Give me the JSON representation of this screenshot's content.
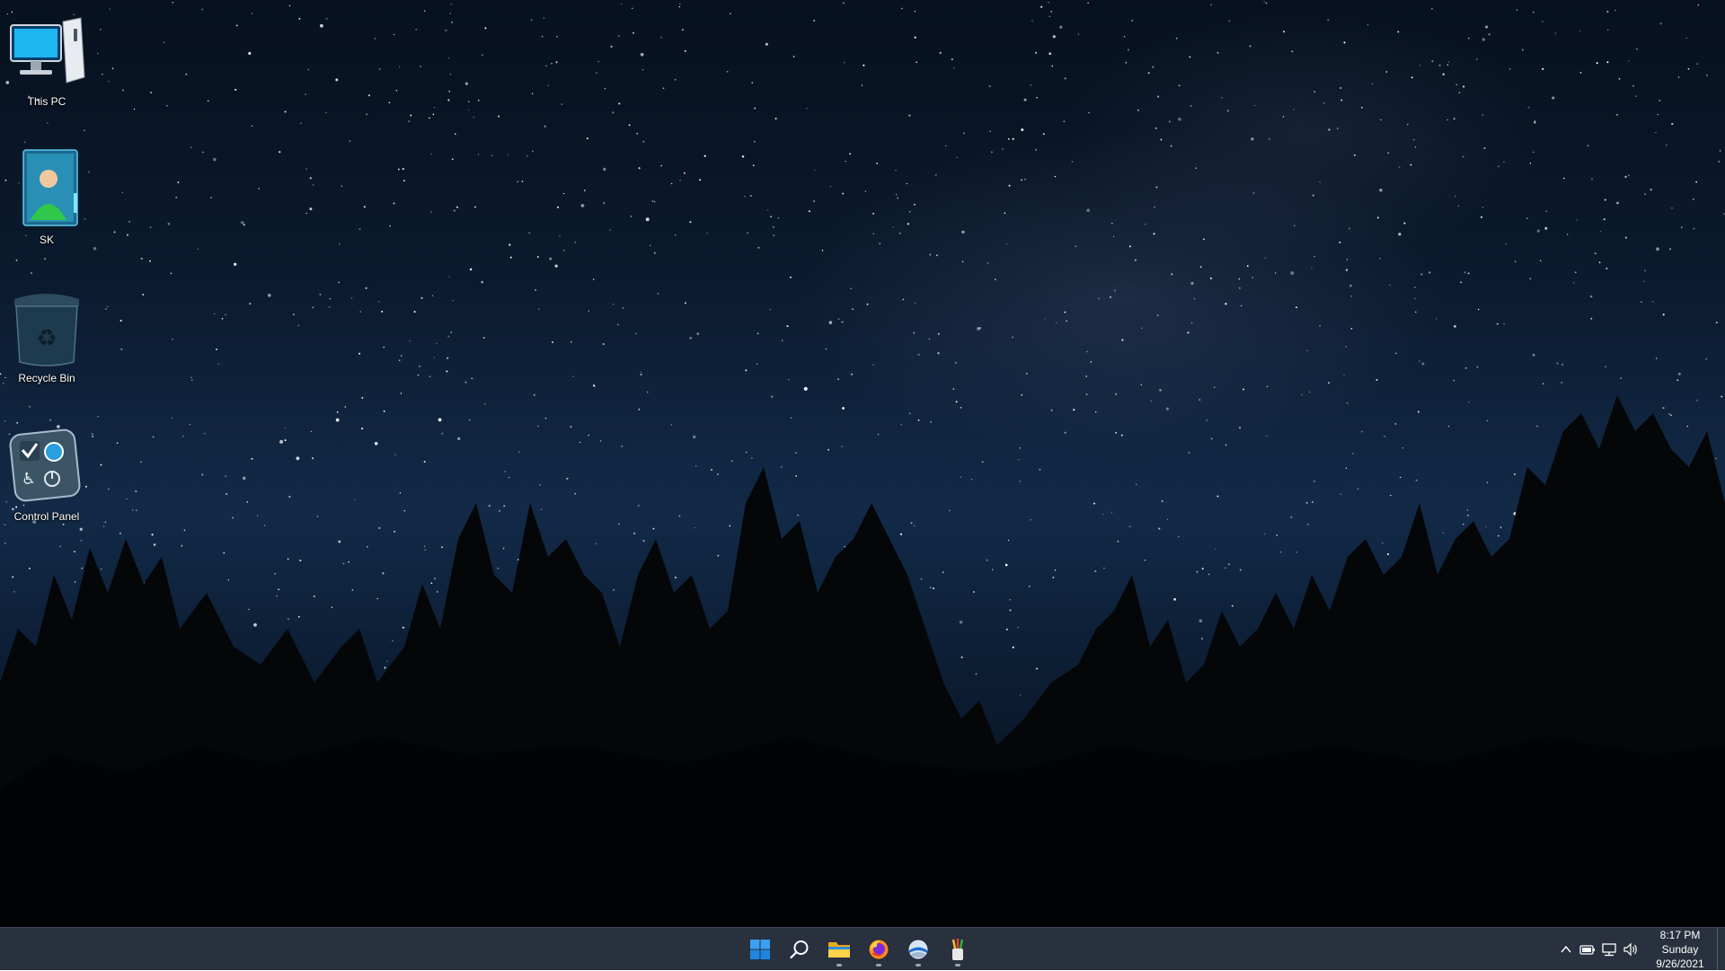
{
  "desktop": {
    "icons": [
      {
        "label": "This PC",
        "icon": "computer-icon"
      },
      {
        "label": "SK",
        "icon": "user-folder-icon"
      },
      {
        "label": "Recycle Bin",
        "icon": "recycle-bin-icon"
      },
      {
        "label": "Control Panel",
        "icon": "control-panel-icon"
      }
    ]
  },
  "taskbar": {
    "apps": [
      {
        "name": "Start",
        "icon": "windows-logo-icon",
        "running": false
      },
      {
        "name": "Search",
        "icon": "search-icon",
        "running": false
      },
      {
        "name": "File Explorer",
        "icon": "folder-icon",
        "running": true
      },
      {
        "name": "Firefox",
        "icon": "firefox-icon",
        "running": true
      },
      {
        "name": "Browser",
        "icon": "globe-app-icon",
        "running": true
      },
      {
        "name": "Paint brushes",
        "icon": "brushes-icon",
        "running": true
      }
    ],
    "tray": {
      "icons": [
        "chevron-up-icon",
        "battery-icon",
        "network-icon",
        "volume-icon"
      ],
      "time": "8:17 PM",
      "day": "Sunday",
      "date": "9/26/2021"
    },
    "accent_color": "#0078d4"
  }
}
